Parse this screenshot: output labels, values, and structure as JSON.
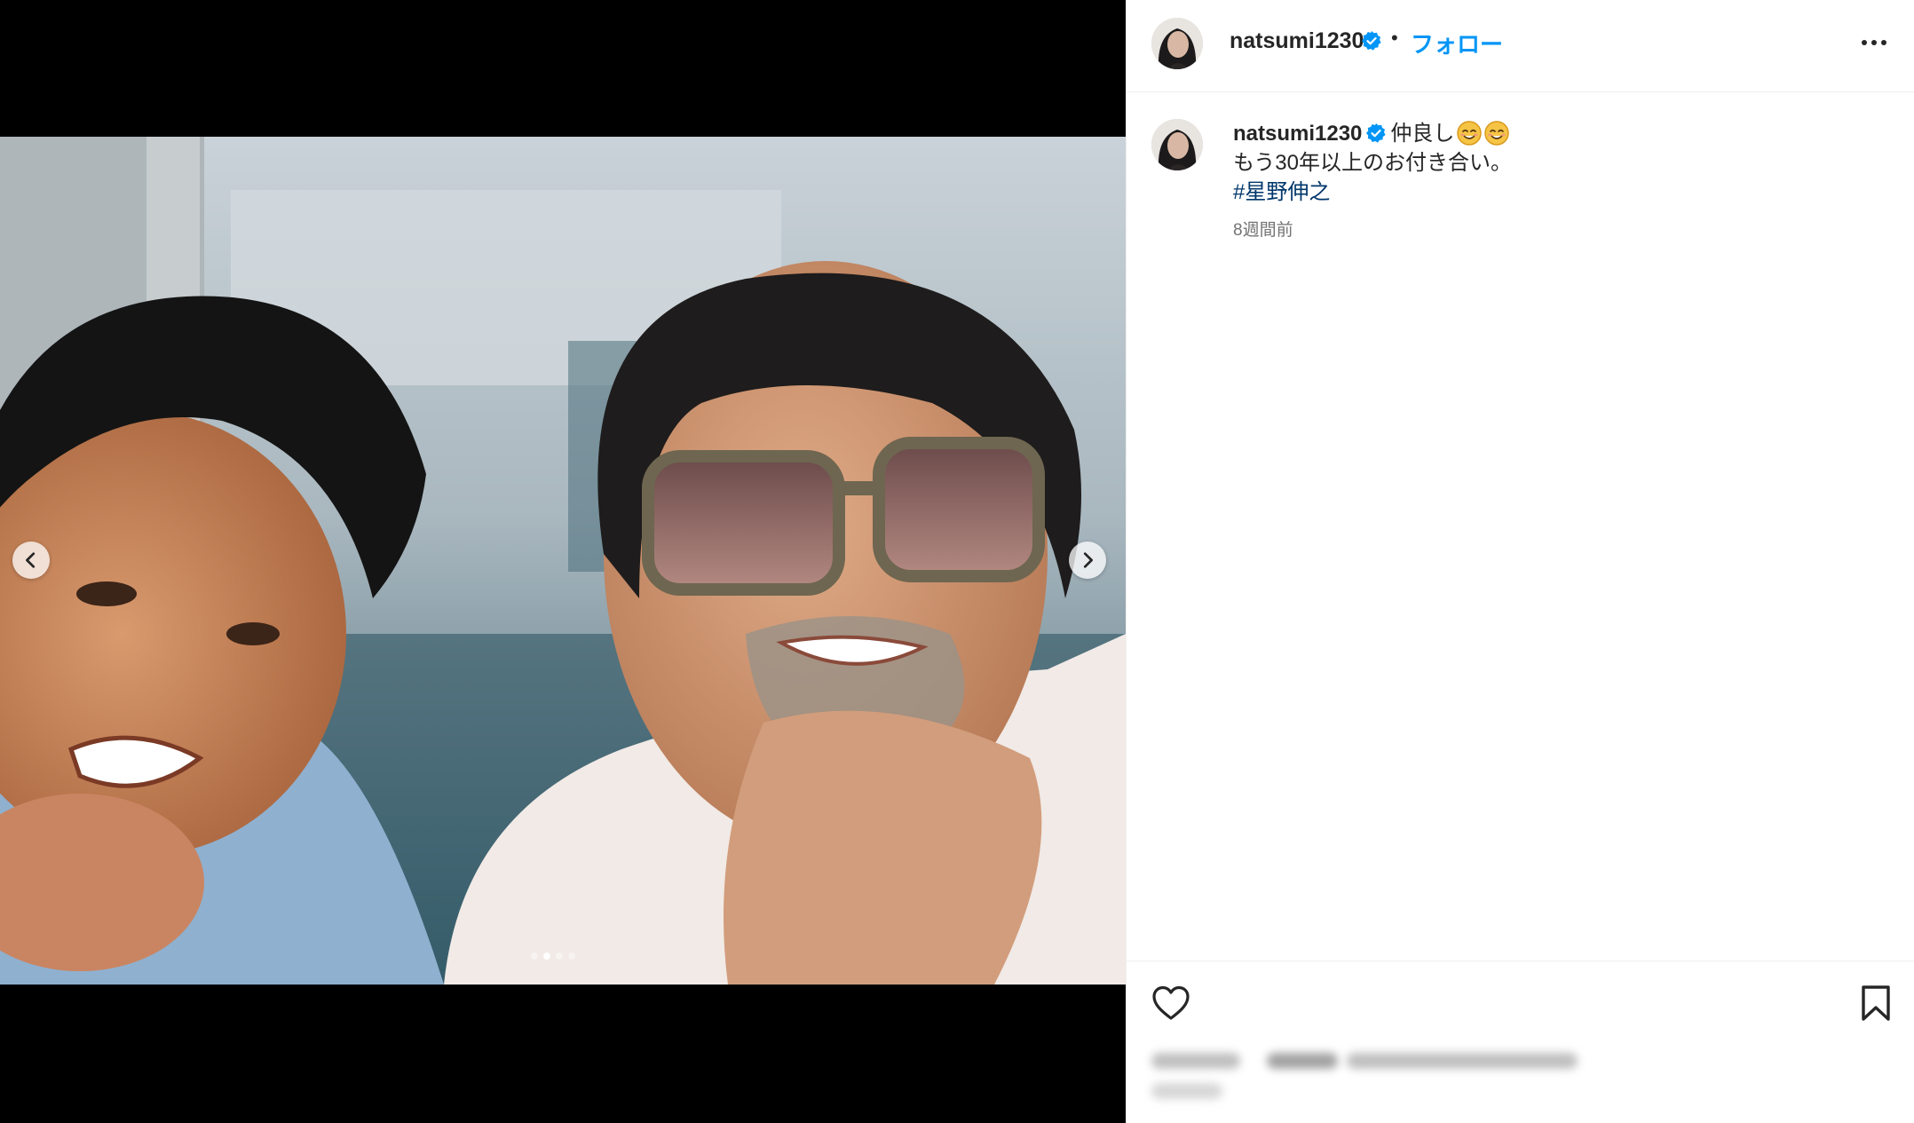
{
  "post": {
    "username": "natsumi1230",
    "follow_label": "フォロー",
    "bullet": "•",
    "caption_line1": "仲良し",
    "caption_line2": "もう30年以上のお付き合い。",
    "hashtag": "#星野伸之",
    "timestamp": "8週間前",
    "emojis": [
      "smiling-face-icon",
      "smiling-face-icon"
    ],
    "carousel": {
      "slide_count": 4,
      "active_slide": 2
    }
  },
  "colors": {
    "accent_blue": "#0095f6",
    "hashtag_blue": "#00376b",
    "verified_blue": "#0095f6",
    "media_background": "#000000"
  }
}
